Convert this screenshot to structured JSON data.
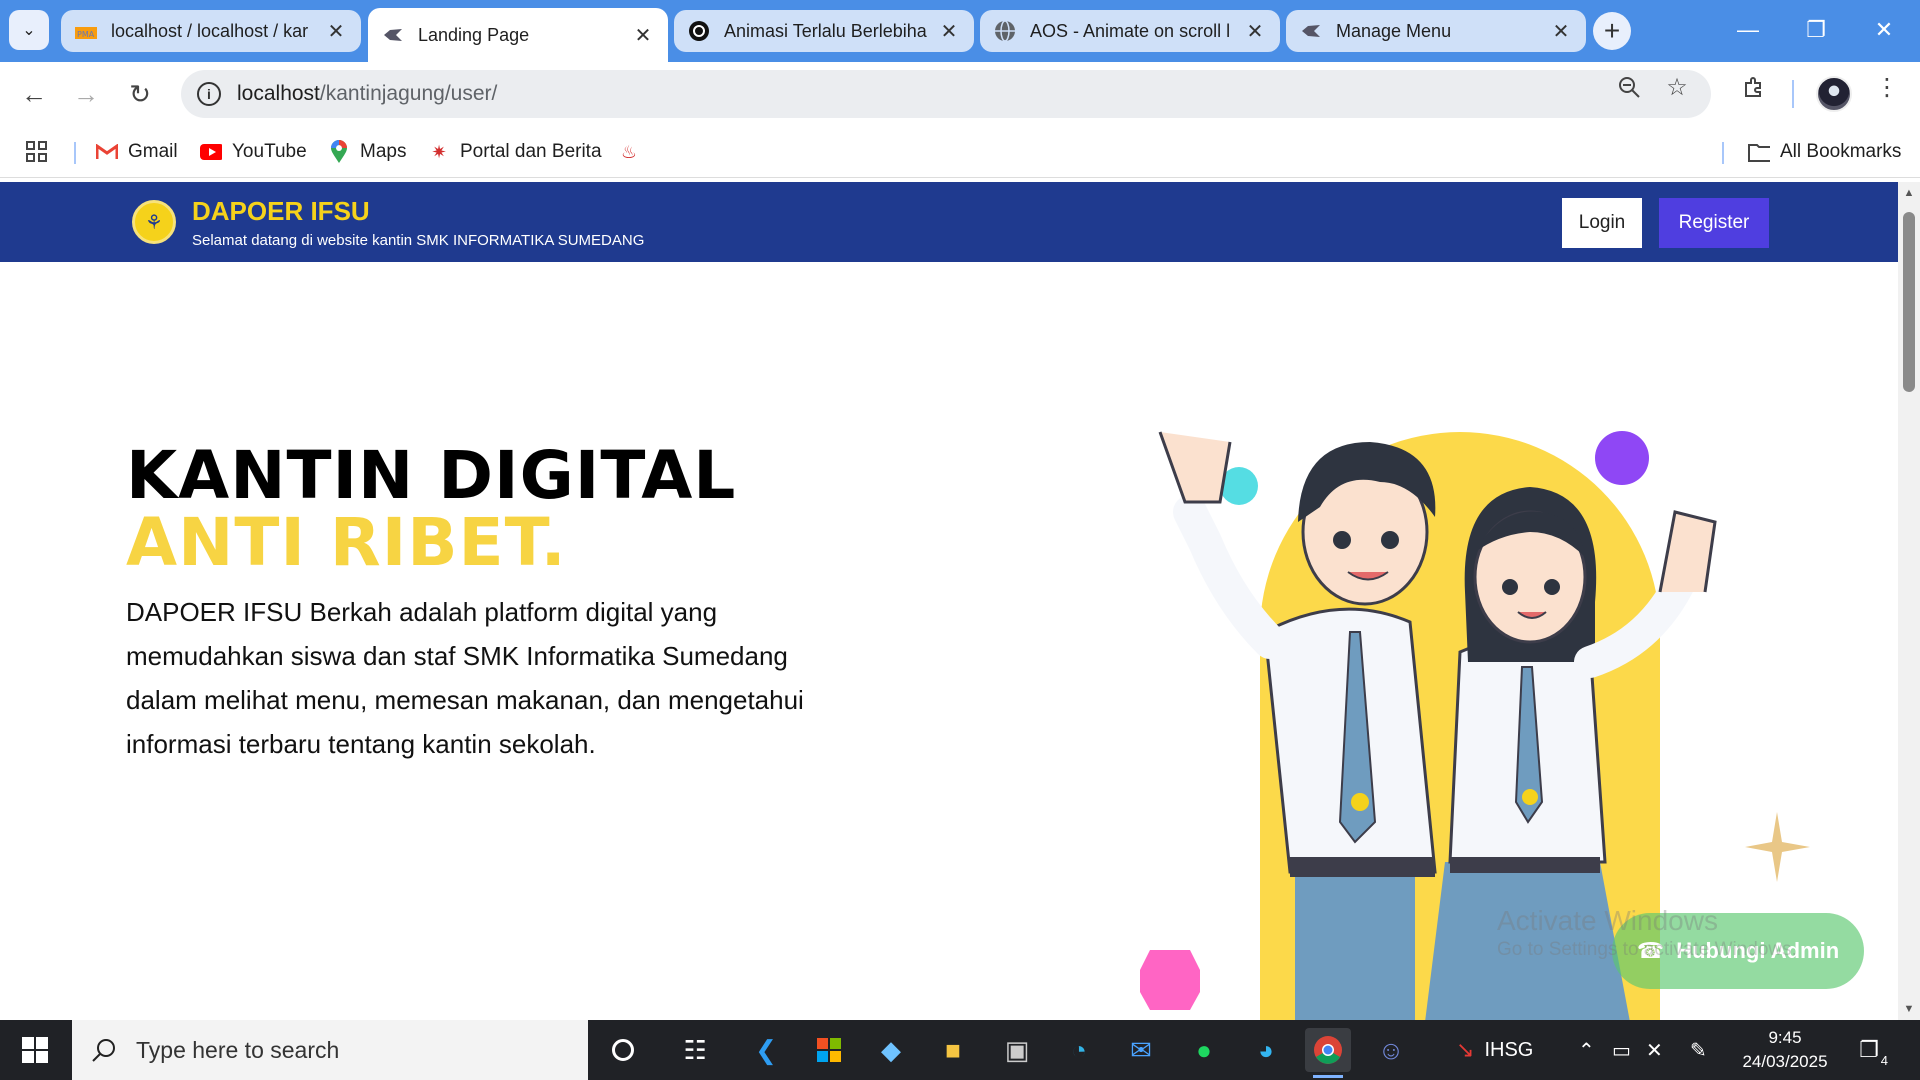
{
  "browser": {
    "tabs": [
      {
        "title": "localhost / localhost / kar",
        "favicon": "phpmyadmin-icon"
      },
      {
        "title": "Landing Page",
        "favicon": "site-logo-icon"
      },
      {
        "title": "Animasi Terlalu Berlebiha",
        "favicon": "chatgpt-icon"
      },
      {
        "title": "AOS - Animate on scroll l",
        "favicon": "globe-icon"
      },
      {
        "title": "Manage Menu",
        "favicon": "site-logo-icon"
      }
    ],
    "active_tab": 1,
    "url_host": "localhost",
    "url_path": "/kantinjagung/user/",
    "bookmarks": [
      {
        "label": "Gmail",
        "icon": "gmail-icon",
        "color": "#ea4335"
      },
      {
        "label": "YouTube",
        "icon": "youtube-icon",
        "color": "#ff0000"
      },
      {
        "label": "Maps",
        "icon": "maps-icon",
        "color": "#34a853"
      },
      {
        "label": "Portal dan Berita",
        "icon": "portal-icon",
        "color": "#d32f2f"
      }
    ],
    "all_bookmarks": "All Bookmarks"
  },
  "site": {
    "brand": "DAPOER IFSU",
    "tagline": "Selamat datang di website kantin SMK INFORMATIKA SUMEDANG",
    "login": "Login",
    "register": "Register",
    "hero_line1": "KANTIN DIGITAL",
    "hero_line2": "ANTI RIBET.",
    "hero_desc": "DAPOER IFSU Berkah adalah platform digital yang memudahkan siswa dan staf SMK Informatika Sumedang dalam melihat menu, memesan makanan, dan mengetahui informasi terbaru tentang kantin sekolah.",
    "contact_button": "Hubungi Admin",
    "colors": {
      "nav": "#1f3a8f",
      "accent_yellow": "#f7d443",
      "register": "#4f3ee0"
    }
  },
  "os": {
    "watermark_title": "Activate Windows",
    "watermark_sub": "Go to Settings to activate Windows.",
    "search_placeholder": "Type here to search",
    "stock_label": "IHSG",
    "time": "9:45",
    "date": "24/03/2025",
    "notifications": "4"
  }
}
